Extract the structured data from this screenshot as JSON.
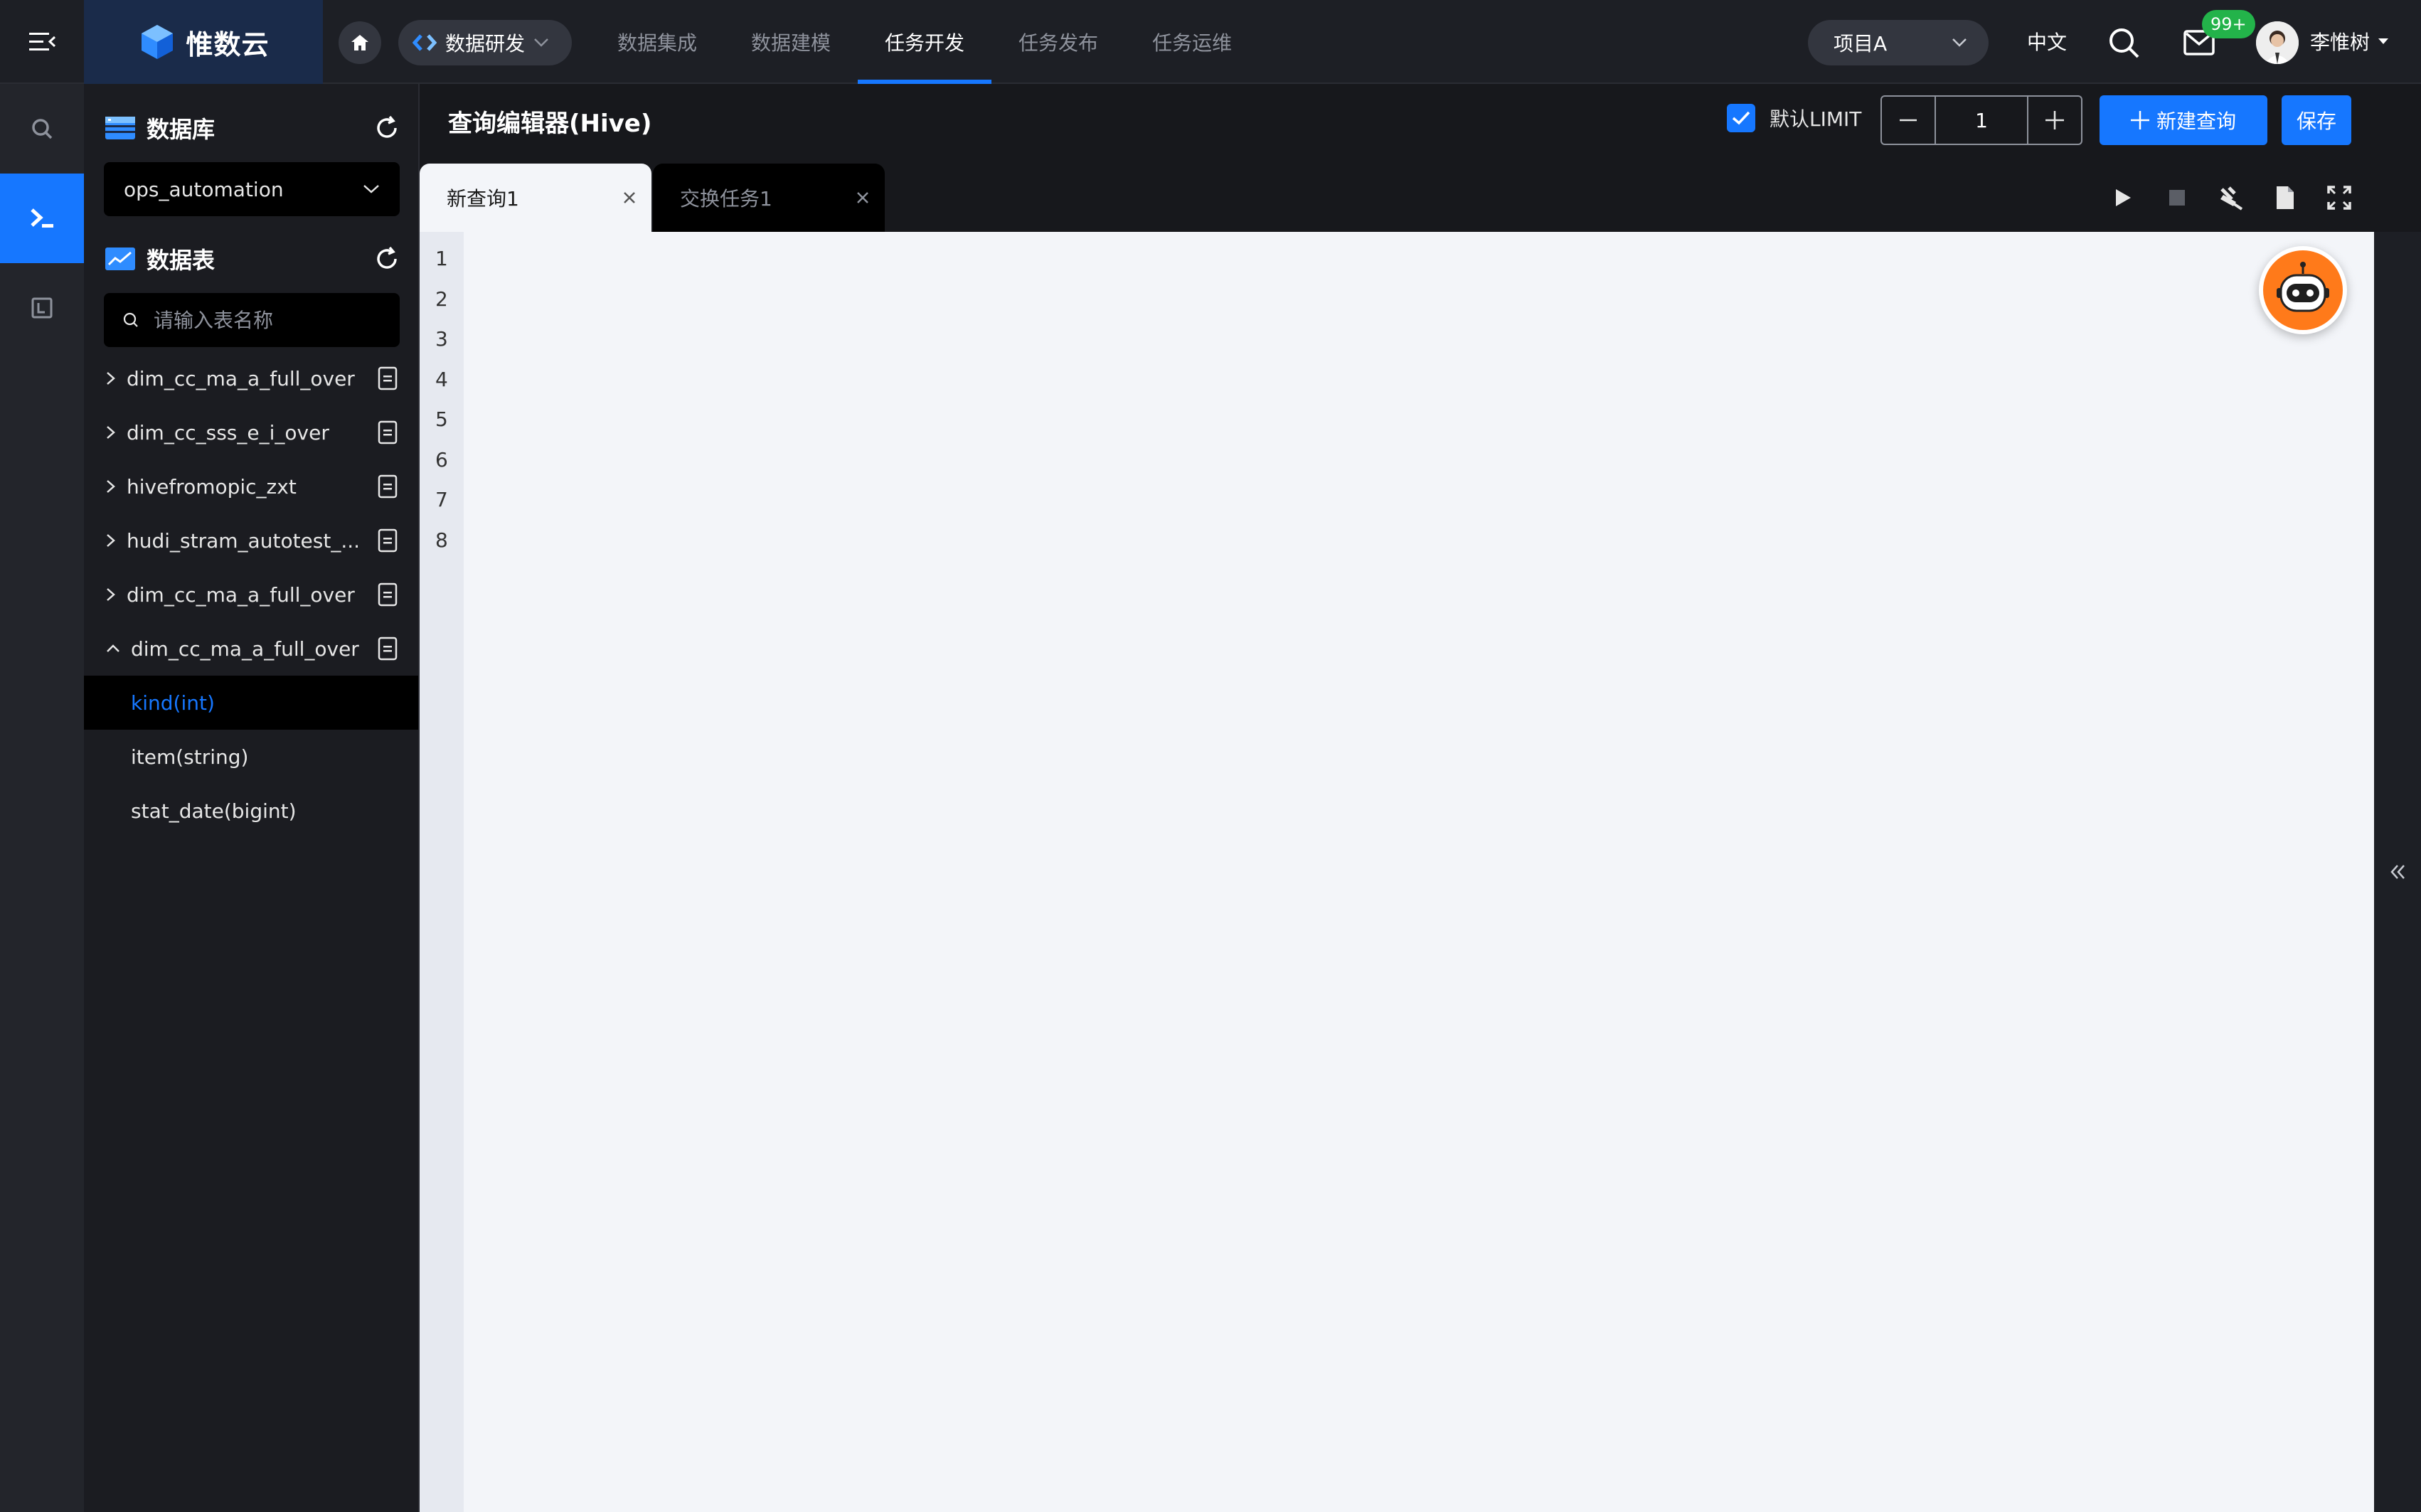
{
  "app": {
    "logo_text": "惟数云",
    "module": "数据研发",
    "nav": [
      {
        "label": "数据集成",
        "active": false
      },
      {
        "label": "数据建模",
        "active": false
      },
      {
        "label": "任务开发",
        "active": true
      },
      {
        "label": "任务发布",
        "active": false
      },
      {
        "label": "任务运维",
        "active": false
      }
    ],
    "project": "项目A",
    "language": "中文",
    "mail_badge": "99+",
    "user_name": "李惟树",
    "accent_color": "#1677ff"
  },
  "rail": {
    "items": [
      "search-icon",
      "terminal-icon",
      "panel-icon"
    ],
    "active_index": 1
  },
  "sidebar": {
    "database_title": "数据库",
    "database_value": "ops_automation",
    "tables_title": "数据表",
    "search_placeholder": "请输入表名称",
    "tables": [
      {
        "name": "dim_cc_ma_a_full_over",
        "expanded": false
      },
      {
        "name": "dim_cc_sss_e_i_over",
        "expanded": false
      },
      {
        "name": "hivefromopic_zxt",
        "expanded": false
      },
      {
        "name": "hudi_stram_autotest_...",
        "expanded": false
      },
      {
        "name": "dim_cc_ma_a_full_over",
        "expanded": false
      },
      {
        "name": "dim_cc_ma_a_full_over",
        "expanded": true
      }
    ],
    "columns": [
      {
        "name": "kind(int)",
        "selected": true
      },
      {
        "name": "item(string)",
        "selected": false
      },
      {
        "name": "stat_date(bigint)",
        "selected": false
      }
    ]
  },
  "editor": {
    "title": "查询编辑器(Hive)",
    "limit_label": "默认LIMIT",
    "limit_checked": true,
    "limit_value": "1",
    "new_query_label": "新建查询",
    "save_label": "保存",
    "tabs": [
      {
        "label": "新查询1",
        "active": true
      },
      {
        "label": "交换任务1",
        "active": false
      }
    ],
    "line_numbers": [
      "1",
      "2",
      "3",
      "4",
      "5",
      "6",
      "7",
      "8"
    ]
  }
}
